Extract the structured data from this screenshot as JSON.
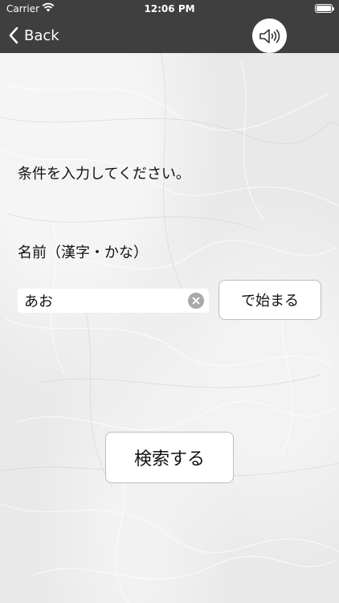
{
  "status_bar": {
    "carrier": "Carrier",
    "time": "12:06 PM"
  },
  "nav": {
    "back_label": "Back",
    "back_icon": "chevron-left-icon",
    "sound_icon": "speaker-wave-icon"
  },
  "form": {
    "instruction": "条件を入力してください。",
    "name_label": "名前（漢字・かな）",
    "name_value": "あお",
    "starts_with_label": "で始まる",
    "search_label": "検索する"
  },
  "colors": {
    "nav_background": "#3f3f3f",
    "paper_background": "#e9e9e9"
  }
}
